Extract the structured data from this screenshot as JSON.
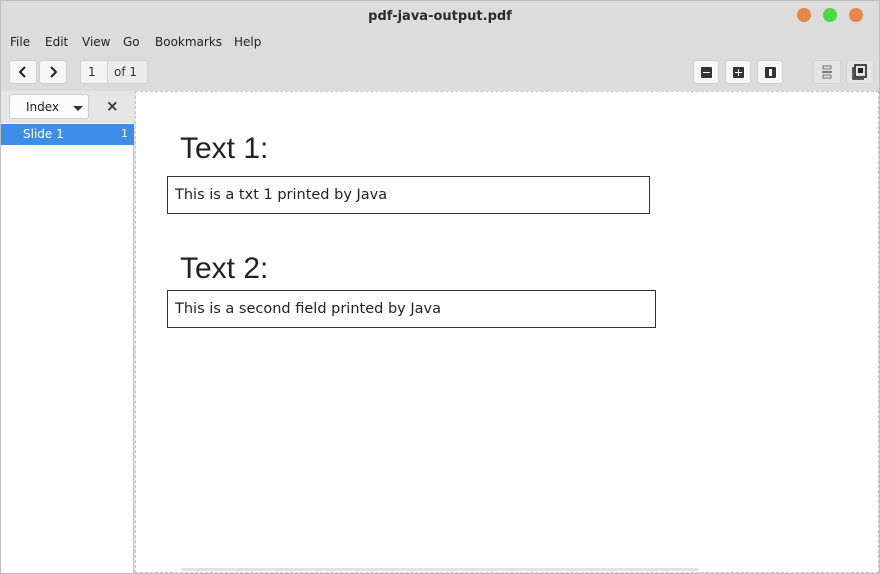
{
  "window": {
    "title": "pdf-java-output.pdf"
  },
  "menu": [
    "File",
    "Edit",
    "View",
    "Go",
    "Bookmarks",
    "Help"
  ],
  "toolbar": {
    "page_current": "1",
    "page_total": "of 1"
  },
  "sidebar": {
    "mode": "Index",
    "items": [
      {
        "label": "Slide 1",
        "page": "1"
      }
    ]
  },
  "document": {
    "sections": [
      {
        "heading": "Text 1:",
        "field_value": "This is a txt 1 printed by Java"
      },
      {
        "heading": "Text 2:",
        "field_value": "This is a second field printed by Java"
      }
    ]
  },
  "colors": {
    "selection": "#3d8ee8",
    "window_min": "#e8864a",
    "window_max": "#4dd849",
    "window_close": "#e8864a"
  }
}
